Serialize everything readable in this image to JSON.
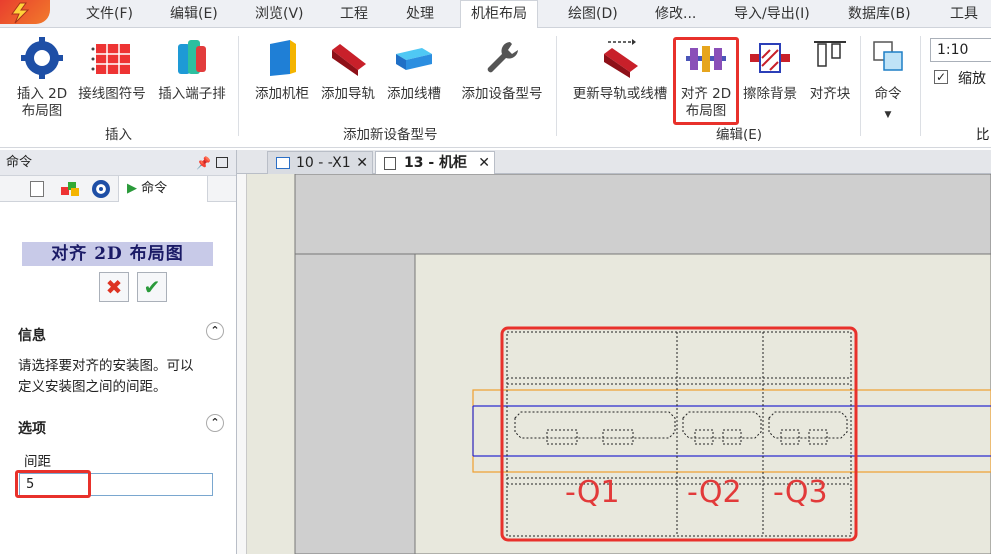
{
  "menu": {
    "items": [
      "文件(F)",
      "编辑(E)",
      "浏览(V)",
      "工程",
      "处理",
      "机柜布局",
      "绘图(D)",
      "修改...",
      "导入/导出(I)",
      "数据库(B)",
      "工具"
    ],
    "active_index": 5
  },
  "ribbon": {
    "insert": {
      "btn1_line1": "插入 2D",
      "btn1_line2": "布局图",
      "btn2": "接线图符号",
      "btn3": "插入端子排",
      "group_label": "插入"
    },
    "add": {
      "btn1": "添加机柜",
      "btn2": "添加导轨",
      "btn3": "添加线槽",
      "btn4": "添加设备型号",
      "group_label": "添加新设备型号"
    },
    "edit": {
      "btn1": "更新导轨或线槽",
      "btn2_line1": "对齐 2D",
      "btn2_line2": "布局图",
      "btn3": "擦除背景",
      "btn4": "对齐块",
      "btn5": "命令",
      "group_label": "编辑(E)"
    },
    "scale": {
      "value": "1:10",
      "checkbox_label": "缩放",
      "right_label": "比"
    }
  },
  "panel": {
    "header": "命令",
    "tab_label": "命令",
    "title": "对齐 2D 布局图",
    "cancel_glyph": "✖",
    "ok_glyph": "✔",
    "info_title": "信息",
    "info_text_1": "请选择要对齐的安装图。可以",
    "info_text_2": "定义安装图之间的间距。",
    "options_title": "选项",
    "spacing_label": "间距",
    "spacing_value": "5"
  },
  "doctabs": {
    "tab1": "10 - -X1",
    "tab2": "13 - 机柜"
  },
  "drawing": {
    "labels": [
      "-Q1",
      "-Q2",
      "-Q3"
    ]
  },
  "colors": {
    "highlight": "#e8312b",
    "accent": "#e8312b",
    "rail": "#f0a030",
    "rail_line": "#2b2bd0"
  }
}
